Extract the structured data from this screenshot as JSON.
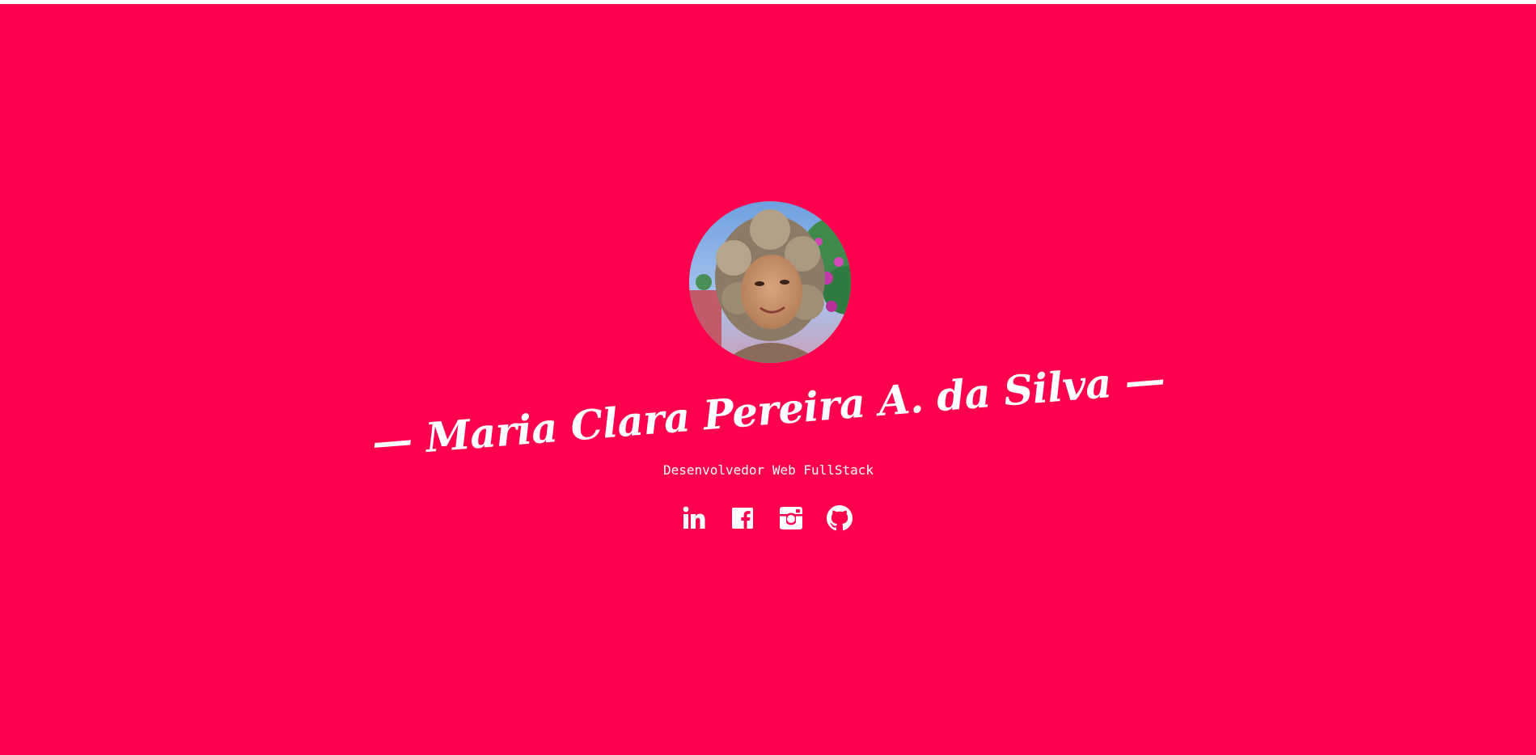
{
  "profile": {
    "name": "— Maria Clara Pereira A. da Silva —",
    "role": "Desenvolvedor Web FullStack",
    "avatar_alt": "Foto de perfil",
    "background_color": "#ff004f",
    "text_color": "#ffffff"
  },
  "socials": [
    {
      "label": "LinkedIn",
      "icon": "linkedin-icon"
    },
    {
      "label": "Facebook",
      "icon": "facebook-icon"
    },
    {
      "label": "Instagram",
      "icon": "instagram-icon"
    },
    {
      "label": "GitHub",
      "icon": "github-icon"
    }
  ]
}
